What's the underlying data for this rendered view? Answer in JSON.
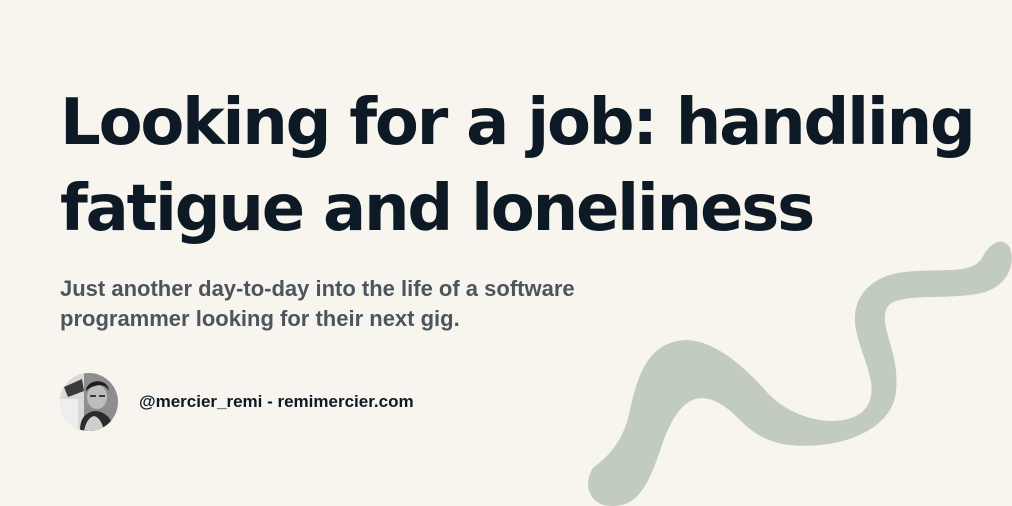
{
  "card": {
    "title": "Looking for a job: handling fatigue and loneliness",
    "subtitle": "Just another day-to-day into the life of a software programmer looking for their next gig.",
    "author": {
      "handle": "@mercier_remi",
      "separator": " - ",
      "website": "remimercier.com",
      "avatar": "author-portrait"
    }
  },
  "colors": {
    "background": "#f8f5ef",
    "title": "#0d1a26",
    "subtitle": "#4d555c",
    "squiggle": "#c1cbc0"
  }
}
